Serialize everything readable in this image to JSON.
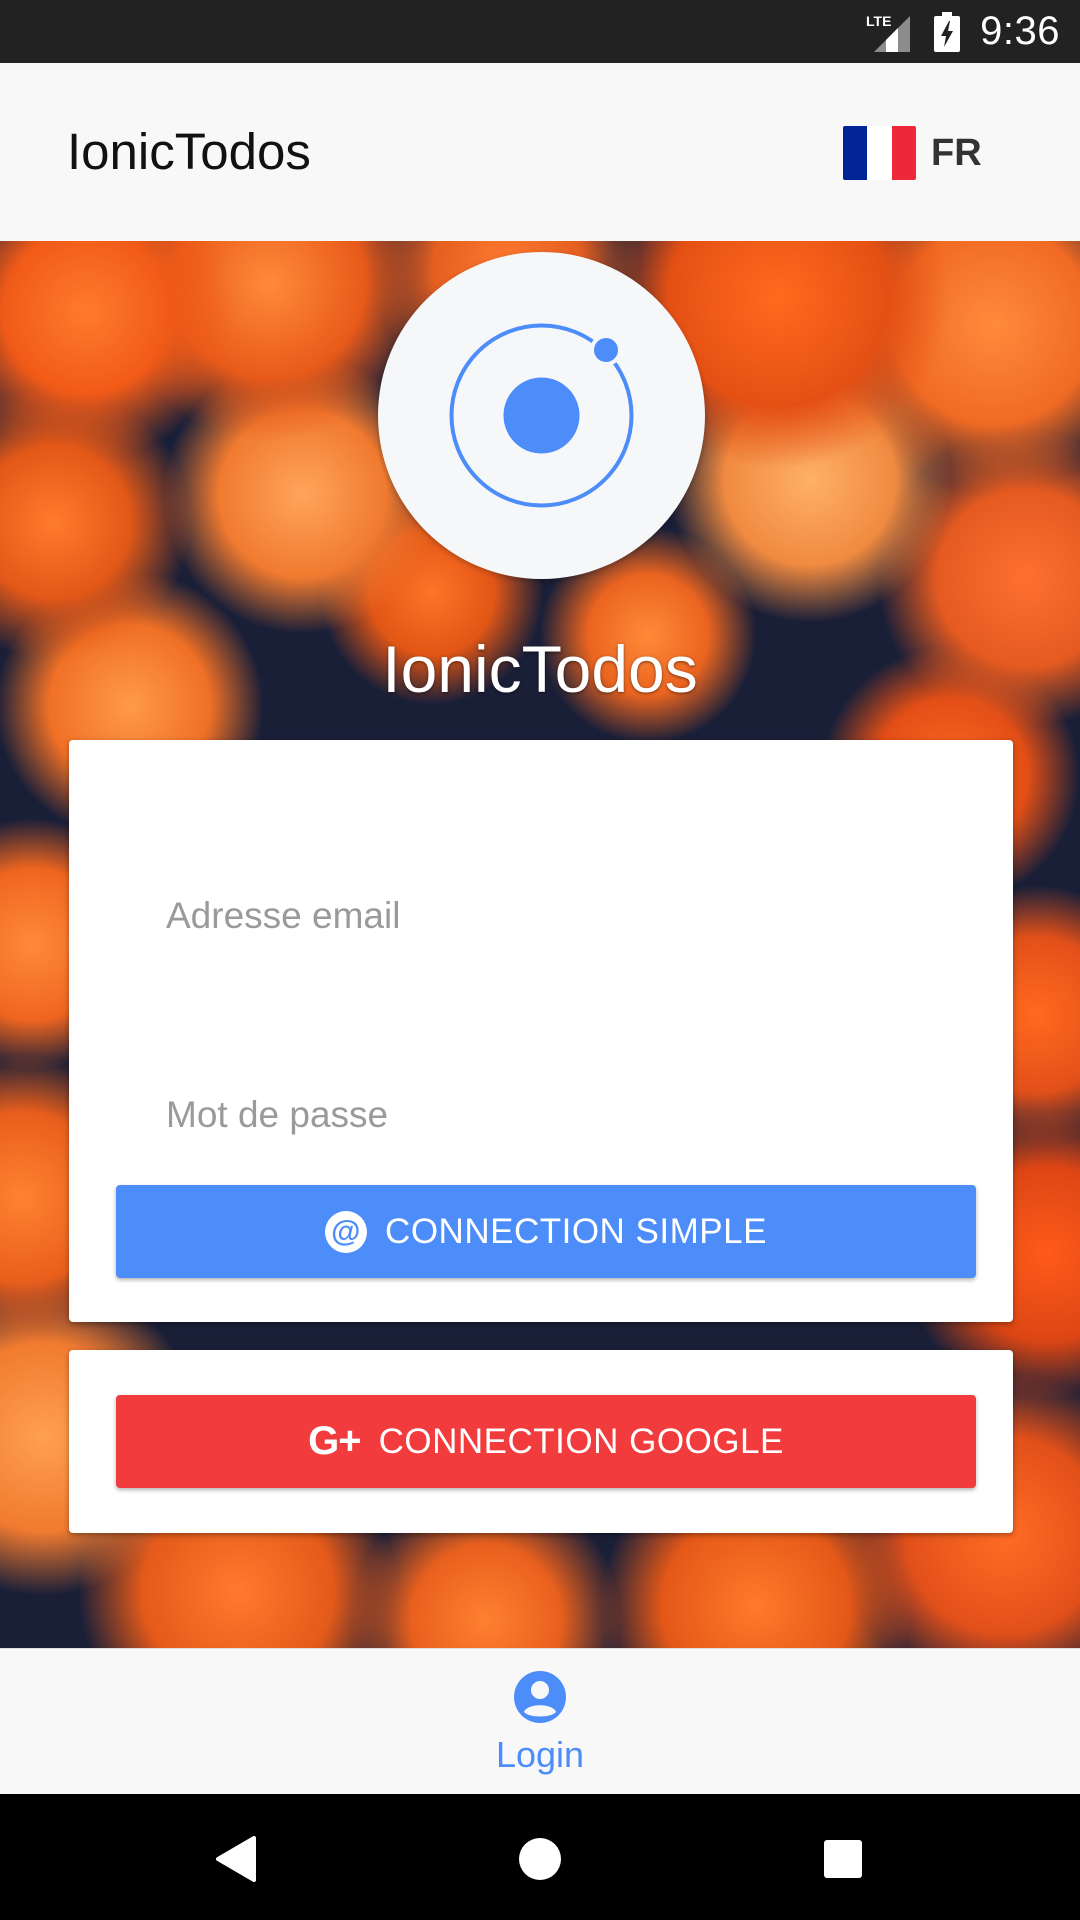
{
  "status_bar": {
    "network_label": "LTE",
    "time": "9:36"
  },
  "header": {
    "title": "IonicTodos",
    "language": {
      "code": "FR",
      "flag_icon": "france-flag-icon",
      "flag_colors": [
        "#002395",
        "#ffffff",
        "#ed2939"
      ]
    }
  },
  "hero": {
    "logo_icon": "ionic-logo-icon",
    "title": "IonicTodos"
  },
  "login_form": {
    "email_placeholder": "Adresse email",
    "email_value": "",
    "password_placeholder": "Mot de passe",
    "password_value": "",
    "simple_button": {
      "label": "CONNECTION SIMPLE",
      "icon": "at-sign-icon",
      "color": "#4c8dfa"
    }
  },
  "google_login": {
    "button": {
      "label": "CONNECTION GOOGLE",
      "icon": "google-plus-icon",
      "color": "#f13b3d"
    }
  },
  "tabs": [
    {
      "label": "Login",
      "icon": "person-circle-icon",
      "active": true,
      "color": "#4c8dfa"
    }
  ],
  "nav_bar": {
    "buttons": [
      "back-icon",
      "home-icon",
      "recents-icon"
    ]
  },
  "colors": {
    "accent": "#4c8dfa",
    "google_red": "#f13b3d",
    "status_bar": "#222222",
    "header_bg": "#f8f8f8"
  }
}
